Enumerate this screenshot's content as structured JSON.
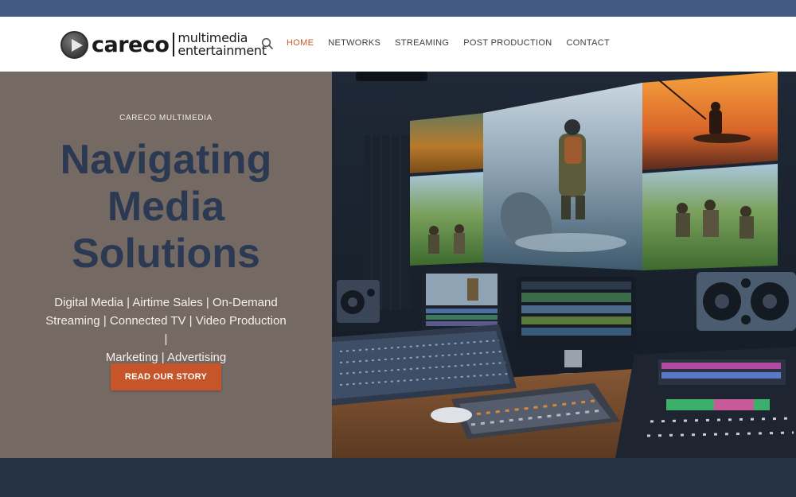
{
  "colors": {
    "top_strip": "#435a83",
    "accent": "#c8582a",
    "hero_left_bg": "#756964",
    "hero_title": "#2b3a52",
    "footer_band": "#253244"
  },
  "brand": {
    "word": "careco",
    "line1": "multimedia",
    "line2": "entertainment",
    "mark_icon": "play-icon"
  },
  "header": {
    "search_icon": "search-icon",
    "nav": [
      {
        "label": "HOME",
        "active": true
      },
      {
        "label": "NETWORKS",
        "active": false
      },
      {
        "label": "STREAMING",
        "active": false
      },
      {
        "label": "POST PRODUCTION",
        "active": false
      },
      {
        "label": "CONTACT",
        "active": false
      }
    ]
  },
  "hero": {
    "eyebrow": "CARECO MULTIMEDIA",
    "title_lines": [
      "Navigating",
      "Media",
      "Solutions"
    ],
    "description_lines": [
      "Digital Media | Airtime Sales | On-Demand",
      "Streaming | Connected TV | Video Production |",
      "Marketing | Advertising"
    ],
    "cta_label": "READ OUR STORY",
    "image_subject": "media-studio-editing-suite"
  }
}
